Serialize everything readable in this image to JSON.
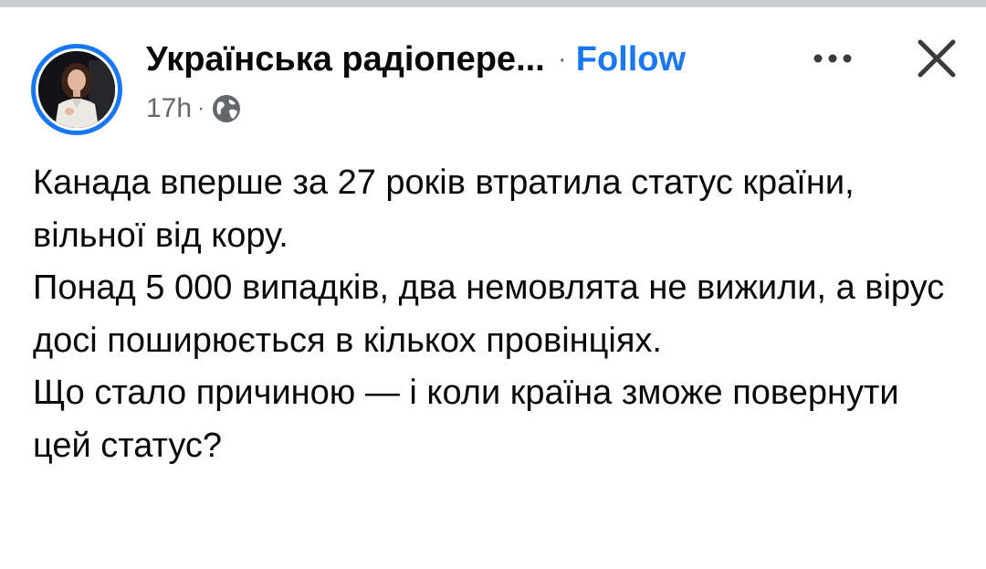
{
  "post": {
    "page_name": "Українська радіопере...",
    "separator": "·",
    "follow_label": "Follow",
    "time": "17h",
    "meta_separator": "·",
    "visibility_icon": "globe-icon",
    "more_icon": "more-options-icon",
    "close_icon": "close-icon",
    "paragraphs": [
      "Канада вперше за 27 років втратила статус країни, вільної від кору.",
      "Понад 5 000 випадків, два немовлята не вижили, а вірус досі поширюється в кількох провінціях.",
      "Що стало причиною — і коли країна зможе повернути цей статус?"
    ]
  },
  "colors": {
    "accent": "#1877f2",
    "text": "#080809",
    "secondary_text": "#65676b",
    "top_strip": "#c9ccd1",
    "background": "#ffffff"
  }
}
